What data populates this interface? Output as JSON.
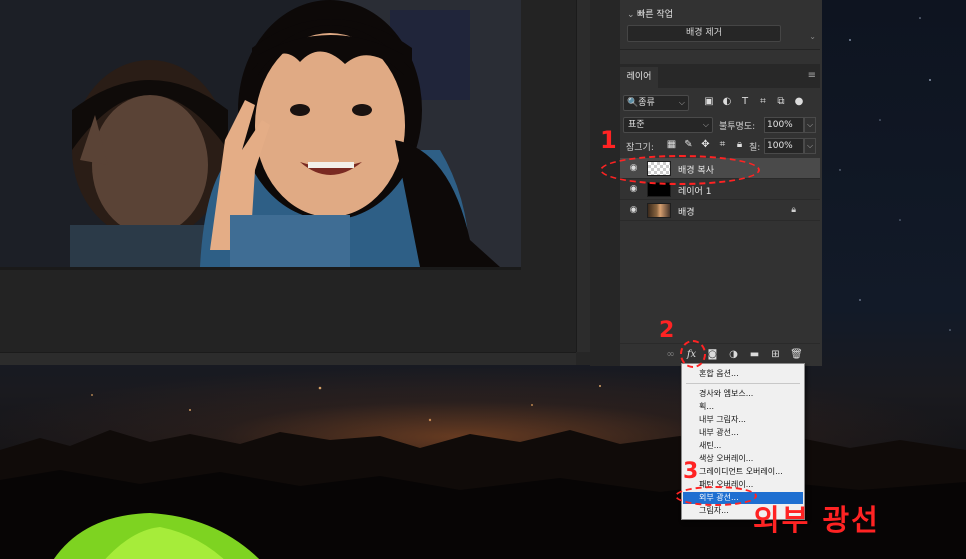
{
  "quick_actions": {
    "title": "빠른 작업",
    "remove_bg_button": "배경 제거"
  },
  "layers_panel": {
    "tab_label": "레이어",
    "filter_kind": "종류",
    "blend_mode": "표준",
    "opacity_label": "불투명도:",
    "opacity_value": "100%",
    "lock_label": "잠그기:",
    "fill_label": "칠:",
    "fill_value": "100%",
    "layers": [
      {
        "name": "배경 복사",
        "selected": true,
        "thumb": "checker",
        "locked": false
      },
      {
        "name": "레이어 1",
        "selected": false,
        "thumb": "black",
        "locked": false
      },
      {
        "name": "배경",
        "selected": false,
        "thumb": "photo",
        "locked": true
      }
    ]
  },
  "fx_menu": {
    "items": [
      "혼합 옵션...",
      "경사와 엠보스...",
      "획...",
      "내부 그림자...",
      "내부 광선...",
      "새틴...",
      "색상 오버레이...",
      "그레이디언트 오버레이...",
      "패턴 오버레이...",
      "외부 광선...",
      "그림자..."
    ],
    "highlighted_item": "외부 광선..."
  },
  "annotations": {
    "step1": "1",
    "step2": "2",
    "step3": "3",
    "caption": "외부 광선",
    "color": "#ff2323"
  }
}
